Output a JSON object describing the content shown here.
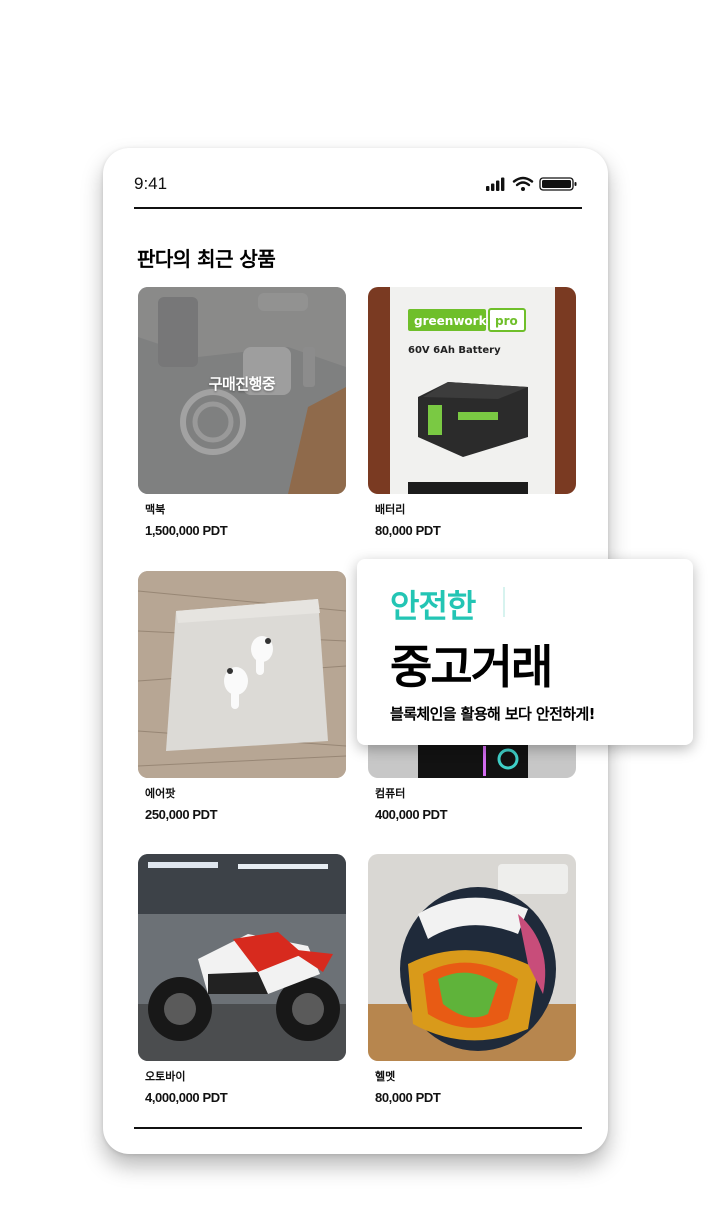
{
  "status": {
    "time": "9:41"
  },
  "section": {
    "title": "판다의 최근 상품"
  },
  "products": [
    {
      "name": "맥북",
      "price": "1,500,000 PDT",
      "badge": "구매진행중"
    },
    {
      "name": "배터리",
      "price": "80,000 PDT",
      "thumb_text": [
        "greenworks",
        "pro",
        "60V 6Ah Battery"
      ]
    },
    {
      "name": "에어팟",
      "price": "250,000 PDT"
    },
    {
      "name": "컴퓨터",
      "price": "400,000 PDT"
    },
    {
      "name": "오토바이",
      "price": "4,000,000 PDT"
    },
    {
      "name": "헬멧",
      "price": "80,000 PDT"
    }
  ],
  "promo": {
    "accent": "안전한",
    "title": "중고거래",
    "subtitle": "블록체인을 활용해 보다 안전하게!"
  },
  "icons": {
    "signal": "signal-icon",
    "wifi": "wifi-icon",
    "battery": "battery-icon"
  },
  "colors": {
    "accent": "#23c5b4",
    "text": "#000000"
  }
}
